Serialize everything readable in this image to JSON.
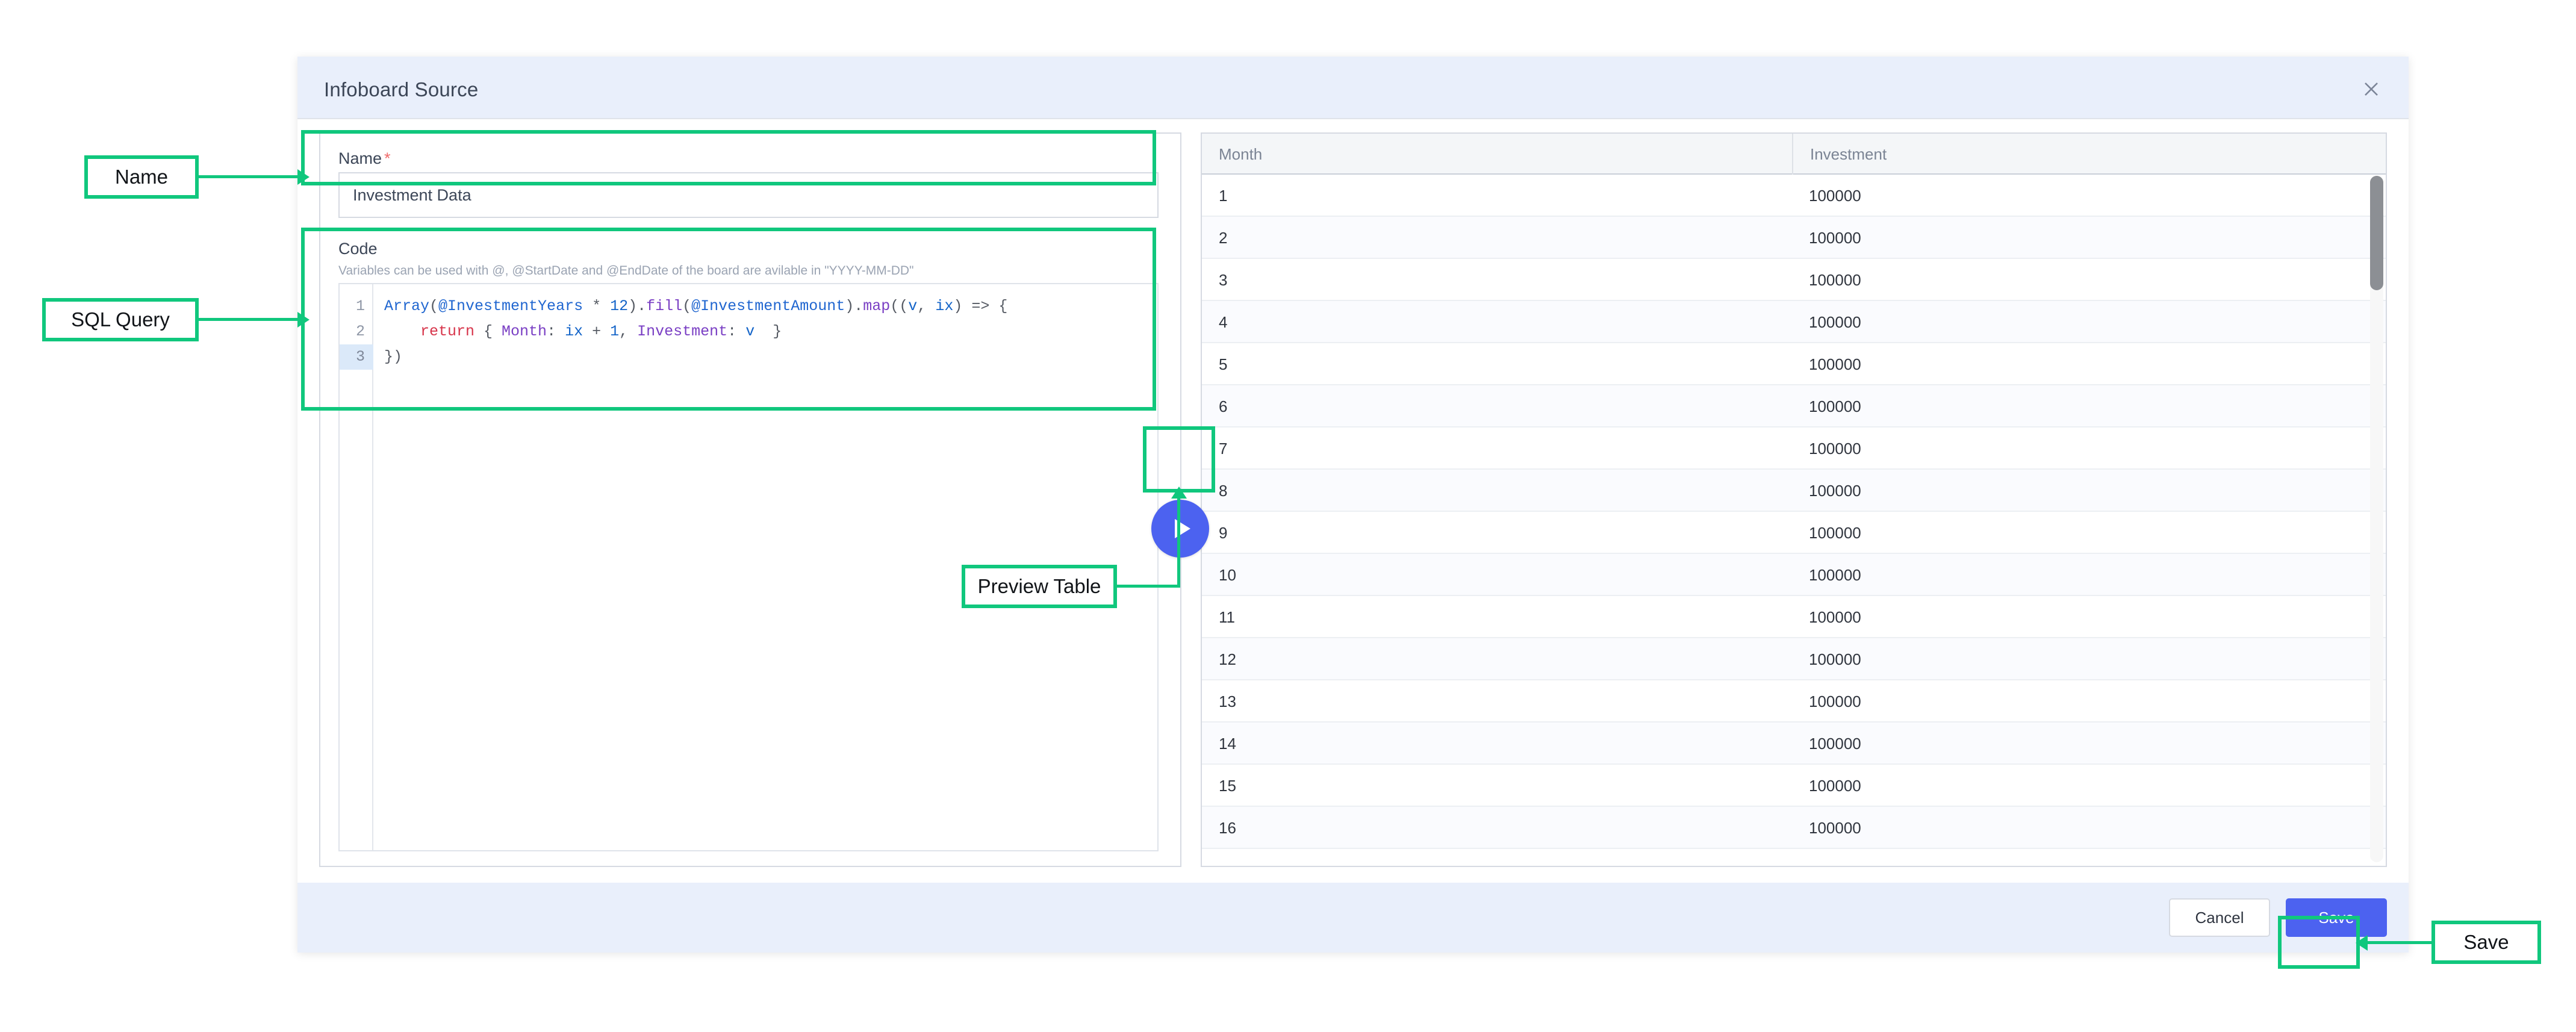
{
  "modal": {
    "title": "Infoboard Source",
    "close_icon": "close-icon"
  },
  "form": {
    "name": {
      "label": "Name",
      "required_marker": "*",
      "value": "Investment Data",
      "placeholder": ""
    },
    "code": {
      "label": "Code",
      "hint": "Variables can be used with @, @StartDate and @EndDate of the board are avilable in \"YYYY-MM-DD\"",
      "lines": [
        {
          "number": "1",
          "active": false
        },
        {
          "number": "2",
          "active": false
        },
        {
          "number": "3",
          "active": true
        }
      ],
      "line1_tokens": [
        {
          "t": "Array",
          "c": "tok-fn"
        },
        {
          "t": "(",
          "c": "tok-punc"
        },
        {
          "t": "@InvestmentYears",
          "c": "tok-var"
        },
        {
          "t": " * ",
          "c": "tok-op"
        },
        {
          "t": "12",
          "c": "tok-num"
        },
        {
          "t": ")",
          "c": "tok-punc"
        },
        {
          "t": ".",
          "c": "tok-punc"
        },
        {
          "t": "fill",
          "c": "tok-meth"
        },
        {
          "t": "(",
          "c": "tok-punc"
        },
        {
          "t": "@InvestmentAmount",
          "c": "tok-var"
        },
        {
          "t": ")",
          "c": "tok-punc"
        },
        {
          "t": ".",
          "c": "tok-punc"
        },
        {
          "t": "map",
          "c": "tok-meth"
        },
        {
          "t": "((",
          "c": "tok-punc"
        },
        {
          "t": "v",
          "c": "tok-num"
        },
        {
          "t": ", ",
          "c": "tok-punc"
        },
        {
          "t": "ix",
          "c": "tok-num"
        },
        {
          "t": ") => {",
          "c": "tok-punc"
        }
      ],
      "line2_tokens": [
        {
          "t": "    ",
          "c": "tok-punc"
        },
        {
          "t": "return",
          "c": "tok-kw"
        },
        {
          "t": " { ",
          "c": "tok-punc"
        },
        {
          "t": "Month",
          "c": "tok-prop"
        },
        {
          "t": ": ",
          "c": "tok-punc"
        },
        {
          "t": "ix",
          "c": "tok-num"
        },
        {
          "t": " + ",
          "c": "tok-op"
        },
        {
          "t": "1",
          "c": "tok-num"
        },
        {
          "t": ", ",
          "c": "tok-punc"
        },
        {
          "t": "Investment",
          "c": "tok-prop"
        },
        {
          "t": ": ",
          "c": "tok-punc"
        },
        {
          "t": "v",
          "c": "tok-num"
        },
        {
          "t": "  }",
          "c": "tok-punc"
        }
      ],
      "line3_tokens": [
        {
          "t": "})",
          "c": "tok-punc"
        }
      ],
      "plain_text": "Array(@InvestmentYears * 12).fill(@InvestmentAmount).map((v, ix) => {\n    return { Month: ix + 1, Investment: v  }\n})"
    }
  },
  "preview": {
    "run_icon": "play-icon",
    "table": {
      "columns": [
        "Month",
        "Investment"
      ],
      "rows": [
        [
          "1",
          "100000"
        ],
        [
          "2",
          "100000"
        ],
        [
          "3",
          "100000"
        ],
        [
          "4",
          "100000"
        ],
        [
          "5",
          "100000"
        ],
        [
          "6",
          "100000"
        ],
        [
          "7",
          "100000"
        ],
        [
          "8",
          "100000"
        ],
        [
          "9",
          "100000"
        ],
        [
          "10",
          "100000"
        ],
        [
          "11",
          "100000"
        ],
        [
          "12",
          "100000"
        ],
        [
          "13",
          "100000"
        ],
        [
          "14",
          "100000"
        ],
        [
          "15",
          "100000"
        ],
        [
          "16",
          "100000"
        ]
      ]
    }
  },
  "footer": {
    "cancel_label": "Cancel",
    "save_label": "Save"
  },
  "annotations": {
    "name": "Name",
    "sql_query": "SQL Query",
    "preview_table": "Preview Table",
    "save": "Save"
  },
  "colors": {
    "accent": "#4c62f0",
    "annotation": "#10c77d",
    "header_bg": "#e9effb",
    "required": "#f06b6b"
  }
}
